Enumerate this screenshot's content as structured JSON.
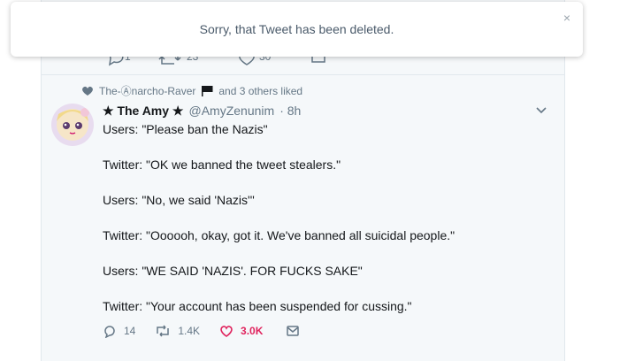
{
  "toast": {
    "message": "Sorry, that Tweet has been deleted."
  },
  "context": {
    "liker": "The-Ⓐnarcho-Raver",
    "suffix": "and 3 others liked"
  },
  "tweet": {
    "name": "★ The Amy ★",
    "handle": "@AmyZenunim",
    "time": "· 8h",
    "lines": [
      "Users: \"Please ban the Nazis\"",
      "Twitter: \"OK we banned the tweet stealers.\"",
      "Users: \"No, we said 'Nazis'\"",
      "Twitter: \"Oooooh, okay, got it. We've banned all suicidal people.\"",
      "Users: \"WE SAID 'NAZIS'. FOR FUCKS SAKE\"",
      "Twitter: \"Your account has been suspended for cussing.\""
    ],
    "replies": "14",
    "retweets": "1.4K",
    "likes": "3.0K"
  },
  "prev_actions": {
    "retweets": "23",
    "likes": "30"
  },
  "colors": {
    "like": "#e0245e",
    "muted": "#657786",
    "bg": "#f5f8fa"
  }
}
